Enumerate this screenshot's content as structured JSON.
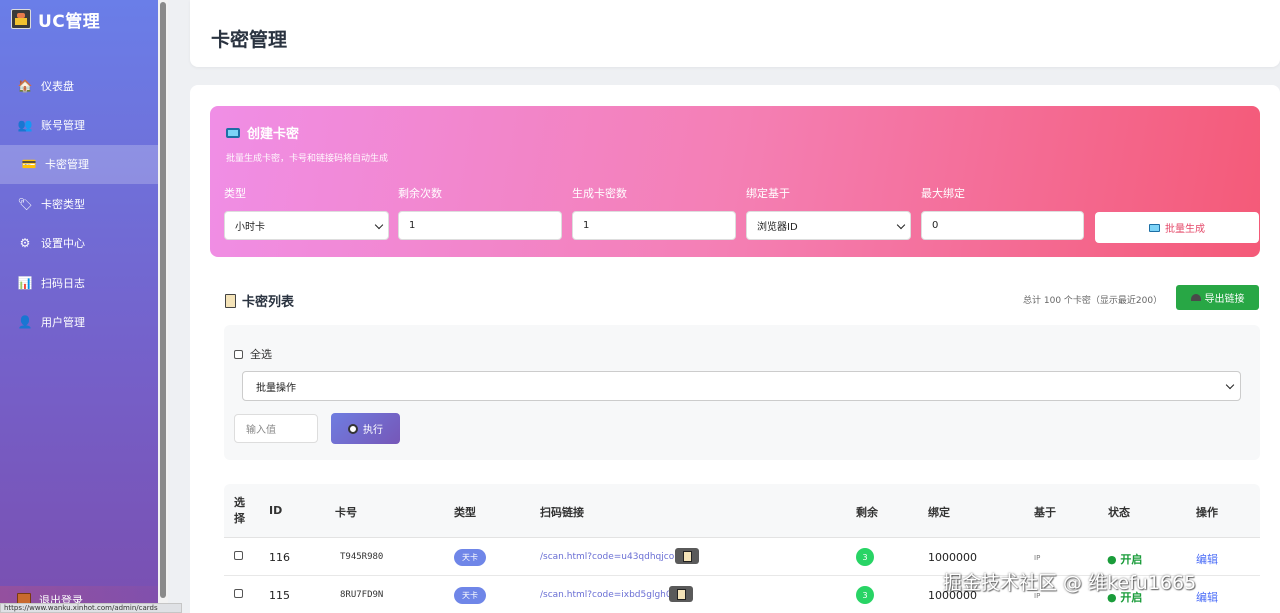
{
  "app": {
    "title": "UC管理"
  },
  "sidebar": {
    "items": [
      {
        "label": "仪表盘",
        "icon": "home-icon"
      },
      {
        "label": "账号管理",
        "icon": "users-icon"
      },
      {
        "label": "卡密管理",
        "icon": "card-icon",
        "active": true
      },
      {
        "label": "卡密类型",
        "icon": "tag-icon"
      },
      {
        "label": "设置中心",
        "icon": "gear-icon"
      },
      {
        "label": "扫码日志",
        "icon": "chart-icon"
      },
      {
        "label": "用户管理",
        "icon": "user-icon"
      }
    ],
    "logout": "退出登录"
  },
  "status_url": "https://www.wanku.xinhot.com/admin/cards",
  "page": {
    "title": "卡密管理"
  },
  "create": {
    "title": "创建卡密",
    "subtitle": "批量生成卡密，卡号和链接码将自动生成",
    "fields": [
      {
        "label": "类型",
        "value": "小时卡",
        "kind": "select"
      },
      {
        "label": "剩余次数",
        "value": "1",
        "kind": "input"
      },
      {
        "label": "生成卡密数",
        "value": "1",
        "kind": "input"
      },
      {
        "label": "绑定基于",
        "value": "浏览器ID",
        "kind": "select"
      },
      {
        "label": "最大绑定",
        "value": "0",
        "kind": "input"
      }
    ],
    "button": "批量生成"
  },
  "list": {
    "title": "卡密列表",
    "total": "总计 100 个卡密（显示最近200）",
    "export": "导出链接",
    "select_all": "全选",
    "bulk_placeholder": "批量操作",
    "input_placeholder": "输入值",
    "execute": "执行",
    "columns": [
      "选择",
      "ID",
      "卡号",
      "类型",
      "扫码链接",
      "剩余",
      "绑定",
      "基于",
      "状态",
      "操作"
    ],
    "rows": [
      {
        "id": "116",
        "card": "T945R980",
        "type": "天卡",
        "link": "/scan.html?code=u43qdhqjcond",
        "remain": "3",
        "bind": "1000000",
        "basis": "IP",
        "state": "● 开启",
        "action": "编辑"
      },
      {
        "id": "115",
        "card": "8RU7FD9N",
        "type": "天卡",
        "link": "/scan.html?code=ixbd5glgh0gf",
        "remain": "3",
        "bind": "1000000",
        "basis": "IP",
        "state": "● 开启",
        "action": "编辑"
      }
    ]
  },
  "watermark": "掘金技术社区 @ 维kefu1665"
}
